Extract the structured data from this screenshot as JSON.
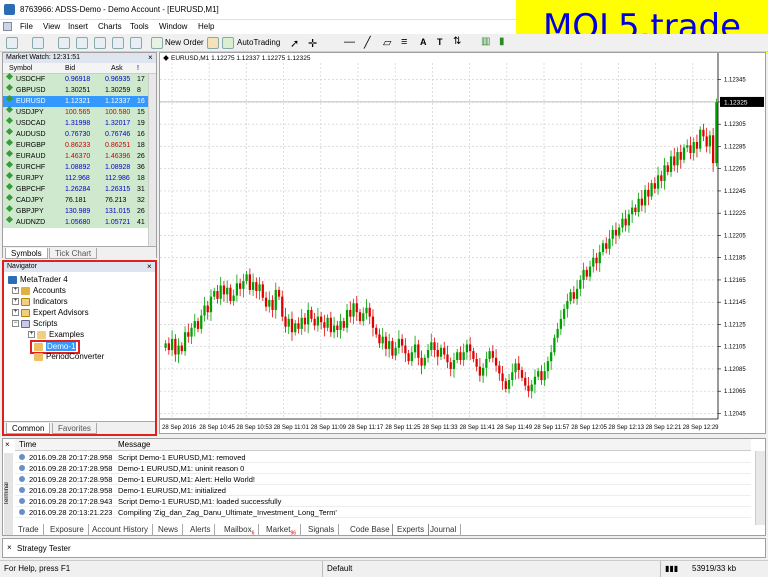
{
  "window": {
    "title": "8763966: ADSS-Demo - Demo Account - [EURUSD,M1]"
  },
  "watermark": "MQL5.trade",
  "menu": [
    "File",
    "View",
    "Insert",
    "Charts",
    "Tools",
    "Window",
    "Help"
  ],
  "toolbar": {
    "new_order": "New Order",
    "autotrading": "AutoTrading"
  },
  "market_watch": {
    "title": "Market Watch: 12:31:51",
    "columns": [
      "Symbol",
      "Bid",
      "Ask",
      "!"
    ],
    "rows": [
      {
        "symbol": "USDCHF",
        "bid": "0.96918",
        "ask": "0.96935",
        "spread": "17",
        "tone": "blue"
      },
      {
        "symbol": "GBPUSD",
        "bid": "1.30251",
        "ask": "1.30259",
        "spread": "8",
        "tone": "normal"
      },
      {
        "symbol": "EURUSD",
        "bid": "1.12321",
        "ask": "1.12337",
        "spread": "16",
        "tone": "sel"
      },
      {
        "symbol": "USDJPY",
        "bid": "100.565",
        "ask": "100.580",
        "spread": "15",
        "tone": "red"
      },
      {
        "symbol": "USDCAD",
        "bid": "1.31998",
        "ask": "1.32017",
        "spread": "19",
        "tone": "blue"
      },
      {
        "symbol": "AUDUSD",
        "bid": "0.76730",
        "ask": "0.76746",
        "spread": "16",
        "tone": "blue"
      },
      {
        "symbol": "EURGBP",
        "bid": "0.86233",
        "ask": "0.86251",
        "spread": "18",
        "tone": "red"
      },
      {
        "symbol": "EURAUD",
        "bid": "1.46370",
        "ask": "1.46396",
        "spread": "26",
        "tone": "red"
      },
      {
        "symbol": "EURCHF",
        "bid": "1.08892",
        "ask": "1.08928",
        "spread": "36",
        "tone": "blue"
      },
      {
        "symbol": "EURJPY",
        "bid": "112.968",
        "ask": "112.986",
        "spread": "18",
        "tone": "blue"
      },
      {
        "symbol": "GBPCHF",
        "bid": "1.26284",
        "ask": "1.26315",
        "spread": "31",
        "tone": "blue"
      },
      {
        "symbol": "CADJPY",
        "bid": "76.181",
        "ask": "76.213",
        "spread": "32",
        "tone": "normal"
      },
      {
        "symbol": "GBPJPY",
        "bid": "130.989",
        "ask": "131.015",
        "spread": "26",
        "tone": "blue"
      },
      {
        "symbol": "AUDNZD",
        "bid": "1.05680",
        "ask": "1.05721",
        "spread": "41",
        "tone": "blue"
      }
    ],
    "tabs": [
      "Symbols",
      "Tick Chart"
    ]
  },
  "navigator": {
    "title": "Navigator",
    "items": [
      "MetaTrader 4",
      "Accounts",
      "Indicators",
      "Expert Advisors",
      "Scripts",
      "Examples",
      "Demo-1",
      "PeriodConverter"
    ],
    "tabs": [
      "Common",
      "Favorites"
    ]
  },
  "chart": {
    "header": "EURUSD,M1  1.12275 1.12337 1.12275 1.12325",
    "current_price": "1.12325"
  },
  "chart_data": {
    "type": "candlestick",
    "symbol": "EURUSD",
    "timeframe": "M1",
    "y_ticks": [
      "1.12345",
      "1.12325",
      "1.12305",
      "1.12285",
      "1.12265",
      "1.12245",
      "1.12225",
      "1.12205",
      "1.12185",
      "1.12165",
      "1.12145",
      "1.12125",
      "1.12105",
      "1.12085",
      "1.12065",
      "1.12045"
    ],
    "x_ticks": [
      "28 Sep 2016",
      "28 Sep 10:45",
      "28 Sep 10:53",
      "28 Sep 11:01",
      "28 Sep 11:09",
      "28 Sep 11:17",
      "28 Sep 11:25",
      "28 Sep 11:33",
      "28 Sep 11:41",
      "28 Sep 11:49",
      "28 Sep 11:57",
      "28 Sep 12:05",
      "28 Sep 12:13",
      "28 Sep 12:21",
      "28 Sep 12:29"
    ],
    "ylim": [
      1.1204,
      1.1236
    ],
    "close": [
      1.12108,
      1.12102,
      1.12112,
      1.12098,
      1.12106,
      1.12101,
      1.12118,
      1.12114,
      1.12122,
      1.12128,
      1.12121,
      1.12133,
      1.12142,
      1.12136,
      1.1215,
      1.12155,
      1.12148,
      1.1216,
      1.12152,
      1.12158,
      1.12146,
      1.12151,
      1.12162,
      1.12157,
      1.12164,
      1.1217,
      1.12156,
      1.12163,
      1.12155,
      1.12161,
      1.12149,
      1.12141,
      1.12147,
      1.12138,
      1.12156,
      1.1215,
      1.12132,
      1.12123,
      1.1213,
      1.12118,
      1.12126,
      1.12121,
      1.12131,
      1.12125,
      1.12138,
      1.1213,
      1.12124,
      1.12132,
      1.12127,
      1.12122,
      1.12131,
      1.12118,
      1.12124,
      1.1212,
      1.12128,
      1.12122,
      1.12138,
      1.12132,
      1.12144,
      1.12136,
      1.12128,
      1.12135,
      1.1214,
      1.12132,
      1.12122,
      1.12116,
      1.12108,
      1.12114,
      1.12103,
      1.1211,
      1.12097,
      1.12104,
      1.12112,
      1.12106,
      1.12099,
      1.12092,
      1.121,
      1.12107,
      1.12095,
      1.12088,
      1.12095,
      1.12102,
      1.12109,
      1.12102,
      1.12096,
      1.12104,
      1.12098,
      1.12091,
      1.12085,
      1.12093,
      1.121,
      1.12093,
      1.121,
      1.12107,
      1.12101,
      1.12094,
      1.12087,
      1.12079,
      1.12086,
      1.12094,
      1.12101,
      1.12095,
      1.12088,
      1.12081,
      1.12074,
      1.12067,
      1.12075,
      1.12082,
      1.1209,
      1.12084,
      1.12077,
      1.1207,
      1.12065,
      1.12071,
      1.12078,
      1.12083,
      1.12075,
      1.12083,
      1.12092,
      1.121,
      1.12113,
      1.12121,
      1.1213,
      1.12139,
      1.12146,
      1.12154,
      1.12148,
      1.12157,
      1.12165,
      1.12174,
      1.12168,
      1.12177,
      1.12185,
      1.1218,
      1.1219,
      1.12198,
      1.12193,
      1.12202,
      1.1221,
      1.12205,
      1.12212,
      1.1222,
      1.12214,
      1.12224,
      1.1223,
      1.12226,
      1.12238,
      1.12232,
      1.12246,
      1.1224,
      1.12252,
      1.12247,
      1.12259,
      1.12254,
      1.12268,
      1.12262,
      1.12276,
      1.12268,
      1.1228,
      1.12273,
      1.12284,
      1.12286,
      1.12279,
      1.12289,
      1.12283,
      1.123,
      1.12294,
      1.12285,
      1.12295,
      1.1227,
      1.12325
    ]
  },
  "terminal": {
    "label": "Terminal",
    "columns": [
      "Time",
      "Message"
    ],
    "rows": [
      {
        "time": "2016.09.28 20:17:28.958",
        "message": "Script Demo-1 EURUSD,M1: removed"
      },
      {
        "time": "2016.09.28 20:17:28.958",
        "message": "Demo-1 EURUSD,M1: uninit reason 0"
      },
      {
        "time": "2016.09.28 20:17:28.958",
        "message": "Demo-1 EURUSD,M1: Alert: Hello World!"
      },
      {
        "time": "2016.09.28 20:17:28.958",
        "message": "Demo-1 EURUSD,M1: initialized"
      },
      {
        "time": "2016.09.28 20:17:28.943",
        "message": "Script Demo-1 EURUSD,M1: loaded successfully"
      },
      {
        "time": "2016.09.28 20:13:21.223",
        "message": "Compiling 'Zig_dan_Zag_Danu_Ultimate_Investment_Long_Term'"
      }
    ],
    "tabs": [
      {
        "label": "Trade",
        "badge": ""
      },
      {
        "label": "Exposure",
        "badge": ""
      },
      {
        "label": "Account History",
        "badge": ""
      },
      {
        "label": "News",
        "badge": ""
      },
      {
        "label": "Alerts",
        "badge": ""
      },
      {
        "label": "Mailbox",
        "badge": "6"
      },
      {
        "label": "Market",
        "badge": "96"
      },
      {
        "label": "Signals",
        "badge": ""
      },
      {
        "label": "Code Base",
        "badge": ""
      },
      {
        "label": "Experts",
        "badge": ""
      },
      {
        "label": "Journal",
        "badge": ""
      }
    ]
  },
  "strategy_tester": "Strategy Tester",
  "status": {
    "help": "For Help, press F1",
    "profile": "Default",
    "traffic": "53919/33 kb"
  }
}
